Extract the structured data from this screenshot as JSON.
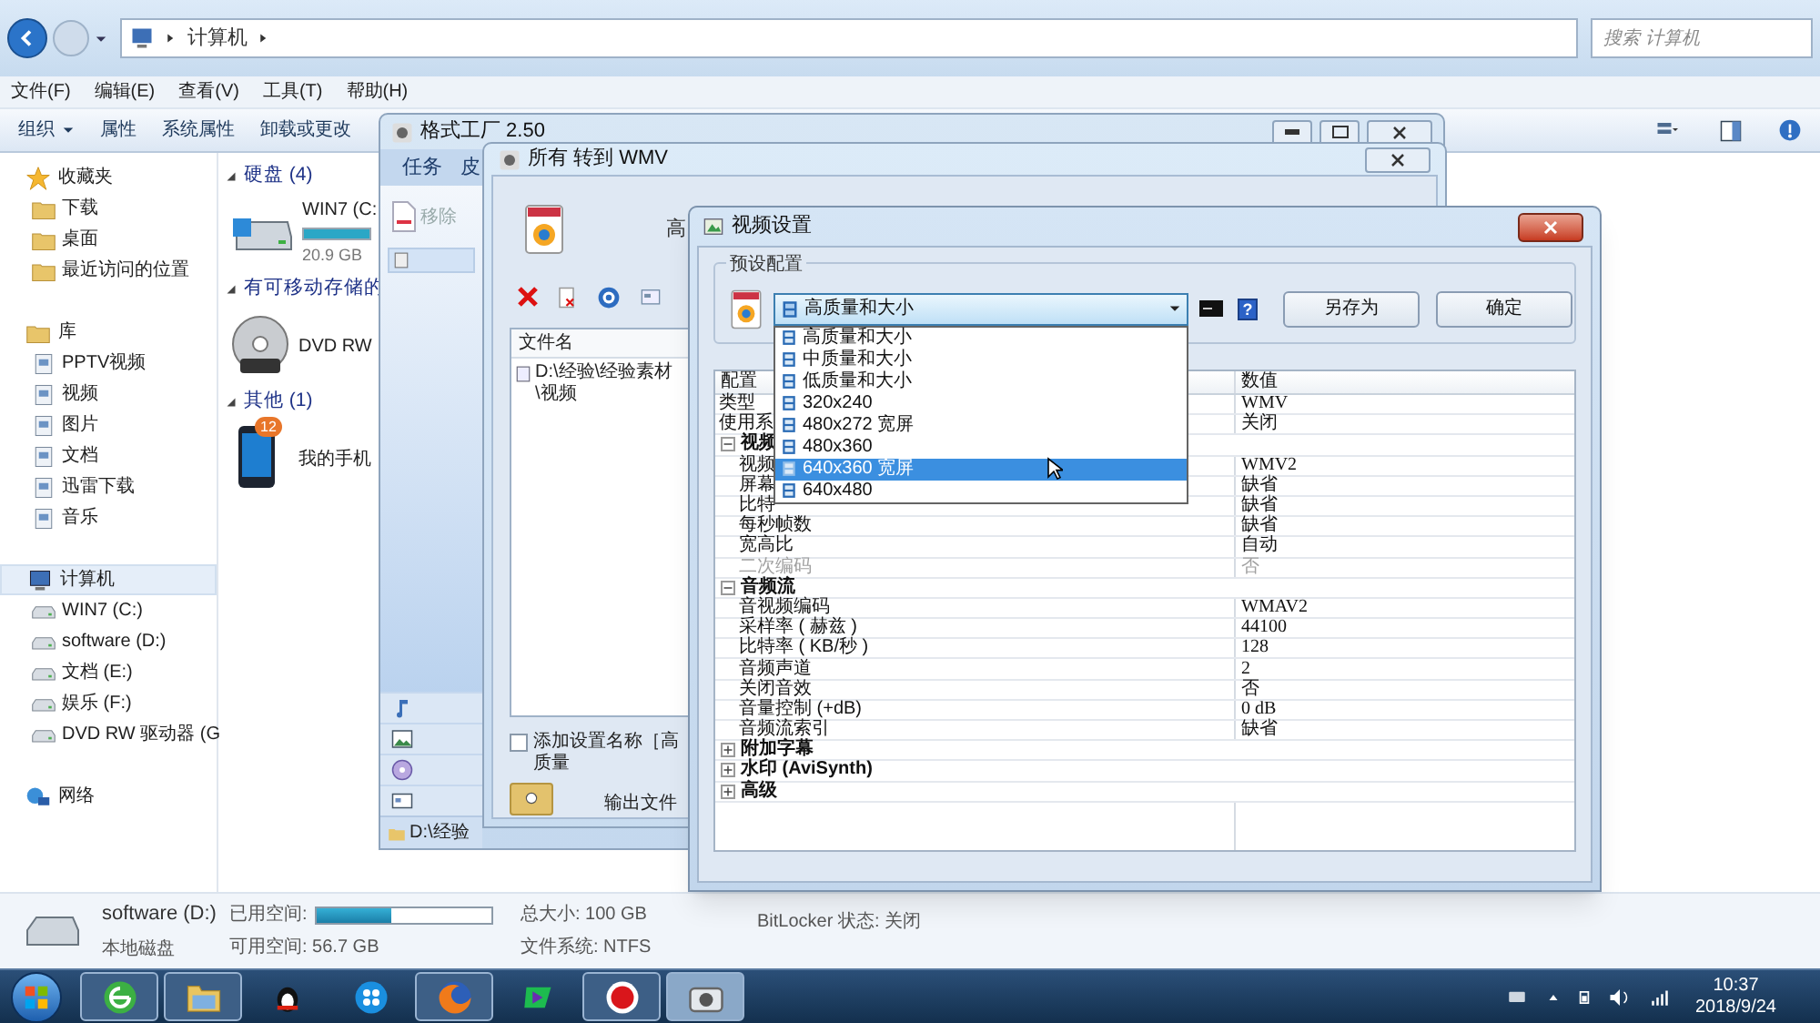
{
  "explorer": {
    "address": [
      "计算机"
    ],
    "search": {
      "placeholder": "搜索 计算机"
    },
    "menu": [
      "文件(F)",
      "编辑(E)",
      "查看(V)",
      "工具(T)",
      "帮助(H)"
    ],
    "toolbar": [
      {
        "label": "组织",
        "kind": "menu"
      },
      {
        "label": "属性",
        "kind": "button"
      },
      {
        "label": "系统属性",
        "kind": "button"
      },
      {
        "label": "卸载或更改",
        "kind": "button"
      }
    ],
    "sidebar": [
      {
        "label": "收藏夹",
        "selected": false,
        "children": [
          {
            "label": "下载",
            "selected": false
          },
          {
            "label": "桌面",
            "selected": false
          },
          {
            "label": "最近访问的位置",
            "selected": false
          }
        ]
      },
      {
        "label": "库",
        "selected": false,
        "children": [
          {
            "label": "PPTV视频",
            "selected": false
          },
          {
            "label": "视频",
            "selected": false
          },
          {
            "label": "图片",
            "selected": false
          },
          {
            "label": "文档",
            "selected": false
          },
          {
            "label": "迅雷下载",
            "selected": false
          },
          {
            "label": "音乐",
            "selected": false
          }
        ]
      },
      {
        "label": "计算机",
        "selected": true,
        "children": [
          {
            "label": "WIN7 (C:)",
            "selected": false
          },
          {
            "label": "software (D:)",
            "selected": false
          },
          {
            "label": "文档 (E:)",
            "selected": false
          },
          {
            "label": "娱乐 (F:)",
            "selected": false
          },
          {
            "label": "DVD RW 驱动器 (G",
            "selected": false
          }
        ]
      },
      {
        "label": "网络",
        "selected": false
      }
    ],
    "sections": [
      {
        "title": "硬盘 (4)",
        "items": [
          {
            "kind": "drive",
            "name": "WIN7 (C:",
            "detail": "20.9 GB",
            "level": 1
          }
        ]
      },
      {
        "title": "有可移动存储的",
        "items": [
          {
            "kind": "disc",
            "name": "DVD RW"
          }
        ]
      },
      {
        "title": "其他 (1)",
        "items": [
          {
            "kind": "phone",
            "name": "我的手机",
            "badge": "12"
          }
        ]
      }
    ],
    "status": {
      "drive": "software (D:)",
      "type": "本地磁盘",
      "used_label": "已用空间:",
      "level": 0.43,
      "free": "可用空间: 56.7 GB",
      "total": "总大小: 100 GB",
      "filesystem": "文件系统: NTFS",
      "bitlocker": "BitLocker 状态: 关闭"
    }
  },
  "format_factory": {
    "title": "格式工厂 2.50",
    "tabs": [
      "任务",
      "皮"
    ],
    "task_item": "移除",
    "status": "D:\\经验"
  },
  "convert_window": {
    "title": "所有 转到 WMV",
    "preset_label": "高",
    "file_column": "文件名",
    "files": [
      "D:\\经验\\经验素材\\视频"
    ],
    "add_name": {
      "label": "添加设置名称［高质量",
      "checked": false
    },
    "output_label": "输出文件"
  },
  "dialog": {
    "title": "视频设置",
    "group_label": "预设配置",
    "preset": {
      "value": "高质量和大小",
      "expanded": true
    },
    "help_glyph": "?",
    "buttons": [
      "另存为",
      "确定"
    ],
    "options": [
      {
        "label": "高质量和大小",
        "selected": false
      },
      {
        "label": "中质量和大小",
        "selected": false
      },
      {
        "label": "低质量和大小",
        "selected": false
      },
      {
        "label": "320x240",
        "selected": false
      },
      {
        "label": "480x272 宽屏",
        "selected": false
      },
      {
        "label": "480x360",
        "selected": false
      },
      {
        "label": "640x360 宽屏",
        "selected": true
      },
      {
        "label": "640x480",
        "selected": false
      }
    ],
    "columns": [
      "配置",
      "数值"
    ],
    "rows": [
      {
        "kind": "setting",
        "label": "类型",
        "value": "WMV",
        "disabled": false
      },
      {
        "kind": "setting",
        "label": "使用系",
        "value": "关闭",
        "disabled": false
      },
      {
        "kind": "section",
        "label": "视频",
        "expanded": true,
        "children": [
          {
            "kind": "setting",
            "label": "视频",
            "value": "WMV2",
            "disabled": false
          },
          {
            "kind": "setting",
            "label": "屏幕",
            "value": "缺省",
            "disabled": false
          },
          {
            "kind": "setting",
            "label": "比特",
            "value": "缺省",
            "disabled": false
          },
          {
            "kind": "setting",
            "label": "每秒帧数",
            "value": "缺省",
            "disabled": false
          },
          {
            "kind": "setting",
            "label": "宽高比",
            "value": "自动",
            "disabled": false
          },
          {
            "kind": "setting",
            "label": "二次编码",
            "value": "否",
            "disabled": true
          }
        ]
      },
      {
        "kind": "section",
        "label": "音频流",
        "expanded": true,
        "children": [
          {
            "kind": "setting",
            "label": "音视频编码",
            "value": "WMAV2",
            "disabled": false
          },
          {
            "kind": "setting",
            "label": "采样率 ( 赫兹 )",
            "value": "44100",
            "disabled": false
          },
          {
            "kind": "setting",
            "label": "比特率 ( KB/秒 )",
            "value": "128",
            "disabled": false
          },
          {
            "kind": "setting",
            "label": "音频声道",
            "value": "2",
            "disabled": false
          },
          {
            "kind": "setting",
            "label": "关闭音效",
            "value": "否",
            "disabled": false
          },
          {
            "kind": "setting",
            "label": "音量控制 (+dB)",
            "value": "0 dB",
            "disabled": false
          },
          {
            "kind": "setting",
            "label": "音频流索引",
            "value": "缺省",
            "disabled": false
          }
        ]
      },
      {
        "kind": "section",
        "label": "附加字幕",
        "expanded": false
      },
      {
        "kind": "section",
        "label": "水印 (AviSynth)",
        "expanded": false
      },
      {
        "kind": "section",
        "label": "高级",
        "expanded": false
      }
    ]
  },
  "taskbar": {
    "apps": [
      {
        "open": true,
        "active": false
      },
      {
        "open": true,
        "active": false
      },
      {
        "open": false,
        "active": false
      },
      {
        "open": false,
        "active": false
      },
      {
        "open": true,
        "active": false
      },
      {
        "open": false,
        "active": false
      },
      {
        "open": true,
        "active": false
      },
      {
        "open": true,
        "active": true
      }
    ],
    "time": "10:37",
    "date": "2018/9/24"
  }
}
